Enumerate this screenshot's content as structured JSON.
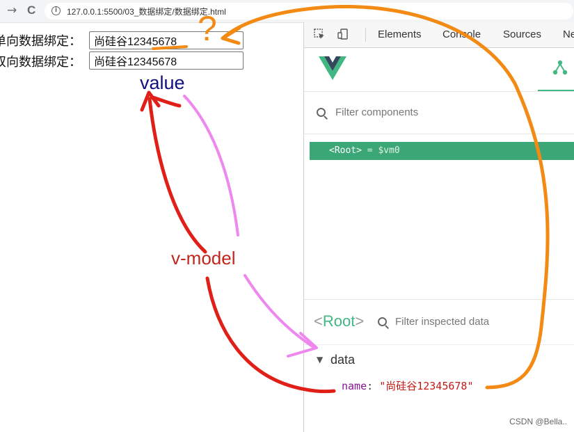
{
  "browser": {
    "back_glyph": "→",
    "reload_glyph": "C",
    "url": "127.0.0.1:5500/03_数据绑定/数据绑定.html"
  },
  "page": {
    "one_way_label": "单向数据绑定：",
    "one_way_value": "尚硅谷12345678",
    "two_way_label": "双向数据绑定：",
    "two_way_value": "尚硅谷12345678"
  },
  "annotations": {
    "value_word": "value",
    "vmodel_word": "v-model",
    "question_mark": "?",
    "colors": {
      "red": "#e02018",
      "pink": "#ee88ee",
      "orange": "#f28a14",
      "blue_word": "#101080"
    }
  },
  "devtools": {
    "tabs": [
      "Elements",
      "Console",
      "Sources",
      "Ne"
    ],
    "icons": [
      "inspect-icon",
      "device-icon",
      "vue-logo-icon",
      "component-tree-icon"
    ],
    "filter_components": "Filter components",
    "root_tag": "<Root>",
    "root_assign": "= $vm0",
    "inspect_root": "Root",
    "filter_inspected": "Filter inspected data",
    "data_section": "data",
    "toggle_glyph": "▼",
    "prop_key": "name",
    "prop_value": "\"尚硅谷12345678\"",
    "accent": "#42b883"
  },
  "watermark": "CSDN @Bella.."
}
